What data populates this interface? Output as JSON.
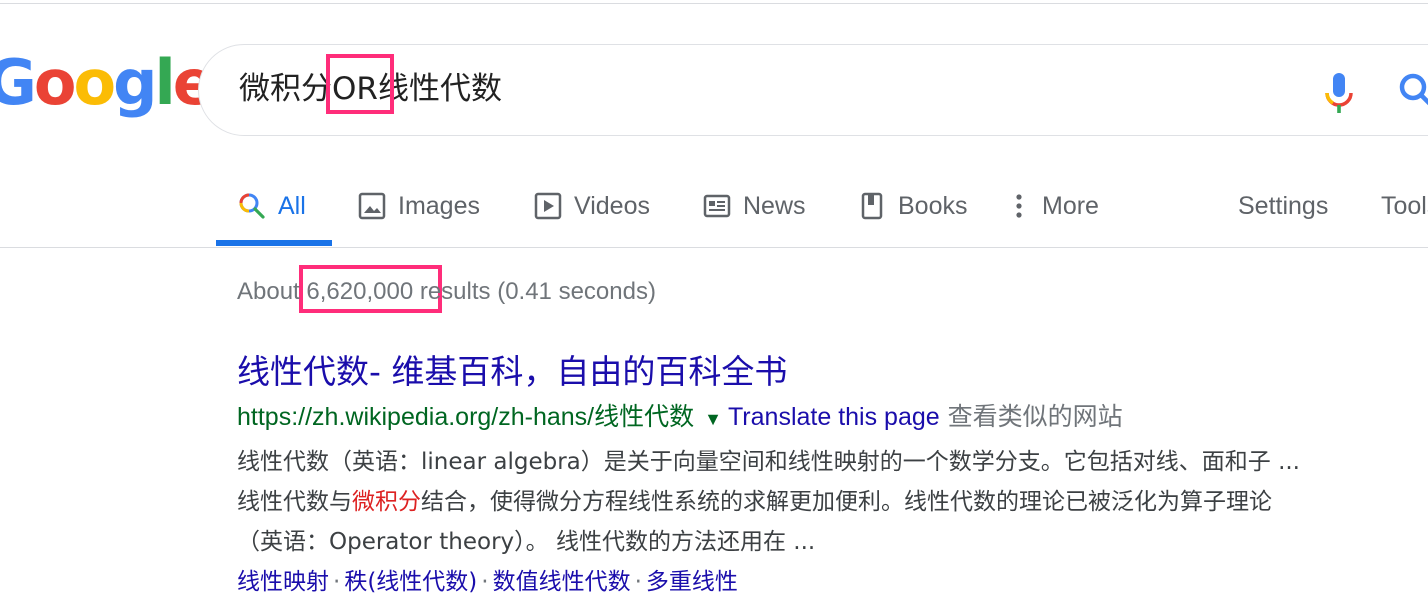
{
  "logo": {
    "letters": [
      "G",
      "o",
      "o",
      "g",
      "l",
      "e"
    ],
    "colors": [
      "#4285F4",
      "#EA4335",
      "#FBBC05",
      "#4285F4",
      "#34A853",
      "#EA4335"
    ]
  },
  "search": {
    "part1": "微积分",
    "part2": "OR",
    "part3": "线性代数"
  },
  "icons": {
    "mic": "microphone-icon",
    "search": "magnifier-icon"
  },
  "tabs": [
    {
      "label": "All",
      "icon": "search-icon"
    },
    {
      "label": "Images",
      "icon": "image-icon"
    },
    {
      "label": "Videos",
      "icon": "play-icon"
    },
    {
      "label": "News",
      "icon": "newspaper-icon"
    },
    {
      "label": "Books",
      "icon": "book-icon"
    },
    {
      "label": "More",
      "icon": "more-vert-icon"
    }
  ],
  "tools": {
    "settings": "Settings",
    "tools": "Tools"
  },
  "stats": {
    "prefix": "About",
    "count": "6,620,000",
    "suffix": "results (0.41 seconds)"
  },
  "result": {
    "title": "线性代数- 维基百科，自由的百科全书",
    "url": "https://zh.wikipedia.org/zh-hans/线性代数",
    "translate": "Translate this page",
    "similar": "查看类似的网站",
    "snippet_line1": "线性代数（英语：linear algebra）是关于向量空间和线性映射的一个数学分支。它包括对线、面和子 ...",
    "snippet_line2_a": "线性代数与",
    "snippet_line2_em": "微积分",
    "snippet_line2_b": "结合，使得微分方程线性系统的求解更加便利。线性代数的理论已被泛化为算子理论",
    "snippet_line3": "（英语：Operator theory）。 线性代数的方法还用在 ...",
    "sitelinks": [
      "线性映射",
      "秩(线性代数)",
      "数值线性代数",
      "多重线性"
    ]
  },
  "colors": {
    "accent": "#1a73e8",
    "highlight": "#ff2d7a",
    "link": "#1a0dab",
    "url": "#006621"
  }
}
